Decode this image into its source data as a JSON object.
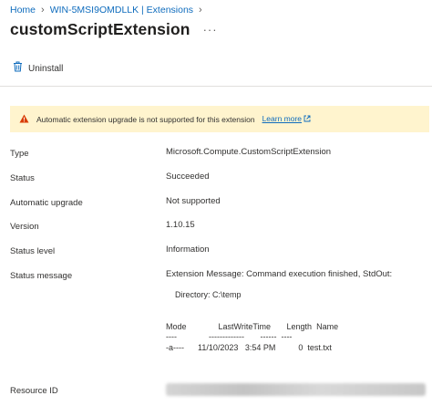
{
  "breadcrumb": {
    "items": [
      "Home",
      "WIN-5MSI9OMDLLK | Extensions"
    ]
  },
  "header": {
    "title": "customScriptExtension",
    "more": "···"
  },
  "toolbar": {
    "uninstall_label": "Uninstall"
  },
  "warning": {
    "text": "Automatic extension upgrade is not supported for this extension",
    "link": "Learn more"
  },
  "properties": {
    "type_label": "Type",
    "type_value": "Microsoft.Compute.CustomScriptExtension",
    "status_label": "Status",
    "status_value": "Succeeded",
    "auto_upgrade_label": "Automatic upgrade",
    "auto_upgrade_value": "Not supported",
    "version_label": "Version",
    "version_value": "1.10.15",
    "status_level_label": "Status level",
    "status_level_value": "Information",
    "status_message_label": "Status message",
    "status_message_line1": "Extension Message: Command execution finished, StdOut:",
    "status_message_dir": "    Directory: C:\\temp",
    "status_message_header": "Mode              LastWriteTime       Length  Name",
    "status_message_dashes": "----              -------------       ------  ----",
    "status_message_row": "-a----      11/10/2023   3:54 PM          0  test.txt",
    "resource_id_label": "Resource ID"
  },
  "colors": {
    "accent": "#0f6cbd",
    "warning_bg": "#fff4ce",
    "warning_icon": "#d83b01"
  }
}
